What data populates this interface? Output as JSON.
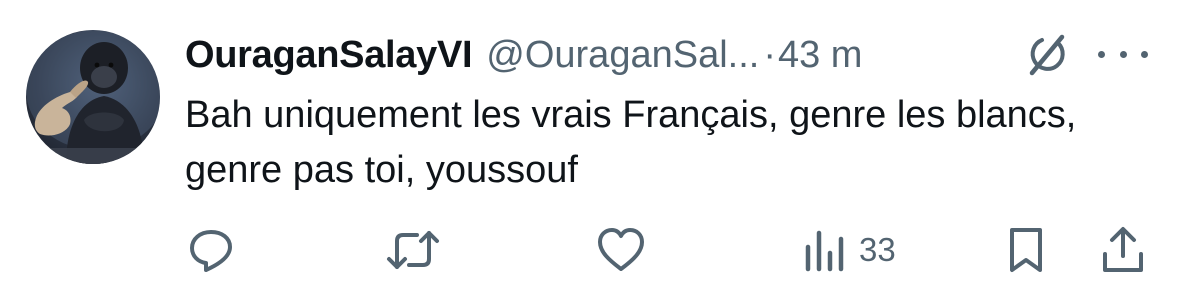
{
  "tweet": {
    "display_name": "OuraganSalayVI",
    "handle": "@OuraganSal...",
    "separator": "·",
    "time": "43 m",
    "text": "Bah uniquement les vrais Français, genre les blancs, genre pas toi, youssouf"
  },
  "actions": {
    "views_count": "33"
  },
  "icons": {
    "grok": "grok-icon",
    "more": "more-horizontal-icon",
    "reply": "reply-icon",
    "retweet": "retweet-icon",
    "like": "heart-icon",
    "views": "analytics-icon",
    "bookmark": "bookmark-icon",
    "share": "share-icon"
  },
  "colors": {
    "text_primary": "#0f1419",
    "text_secondary": "#536471",
    "background": "#ffffff"
  }
}
